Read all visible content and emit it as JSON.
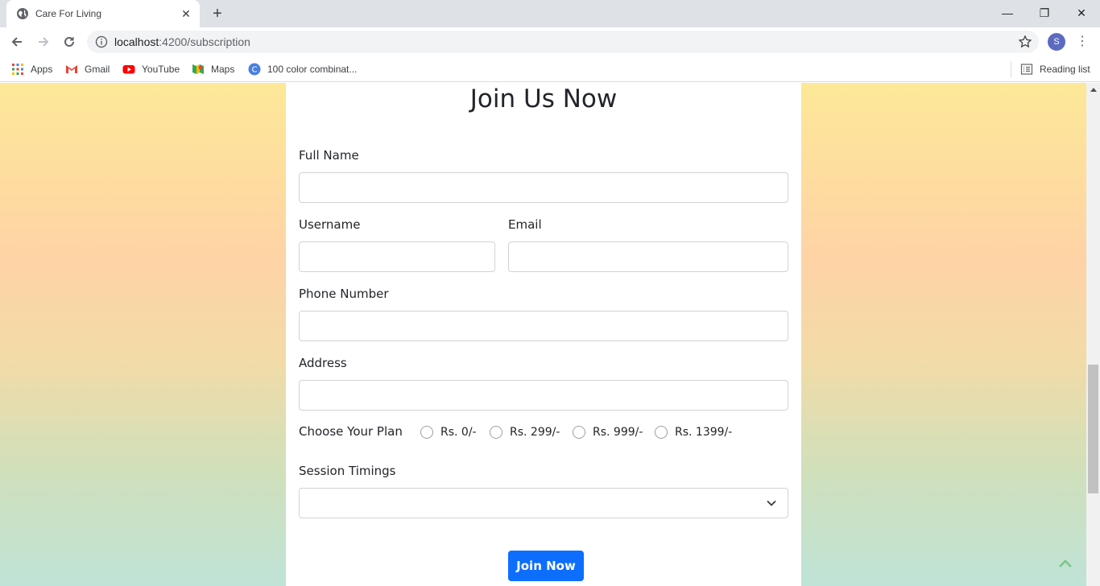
{
  "browser": {
    "tab_title": "Care For Living",
    "tab_close": "✕",
    "new_tab": "+",
    "window_controls": {
      "minimize": "—",
      "restore": "❐",
      "close": "✕"
    },
    "url_host": "localhost",
    "url_path": ":4200/subscription",
    "avatar_letter": "S",
    "menu": "⋮",
    "bookmarks": [
      {
        "label": "Apps",
        "icon": "apps-grid-icon"
      },
      {
        "label": "Gmail",
        "icon": "gmail-icon"
      },
      {
        "label": "YouTube",
        "icon": "youtube-icon"
      },
      {
        "label": "Maps",
        "icon": "maps-icon"
      },
      {
        "label": "100 color combinat...",
        "icon": "site-c-icon"
      }
    ],
    "reading_list": "Reading list"
  },
  "form": {
    "title": "Join Us Now",
    "full_name_label": "Full Name",
    "username_label": "Username",
    "email_label": "Email",
    "phone_label": "Phone Number",
    "address_label": "Address",
    "plan_label": "Choose Your Plan",
    "plans": [
      "Rs. 0/-",
      "Rs. 299/-",
      "Rs. 999/-",
      "Rs. 1399/-"
    ],
    "session_label": "Session Timings",
    "session_value": "",
    "submit_label": "Join Now"
  },
  "colors": {
    "primary_button": "#0d6efd",
    "gradient_top": "#fde898",
    "gradient_bottom": "#bfe3d7"
  }
}
